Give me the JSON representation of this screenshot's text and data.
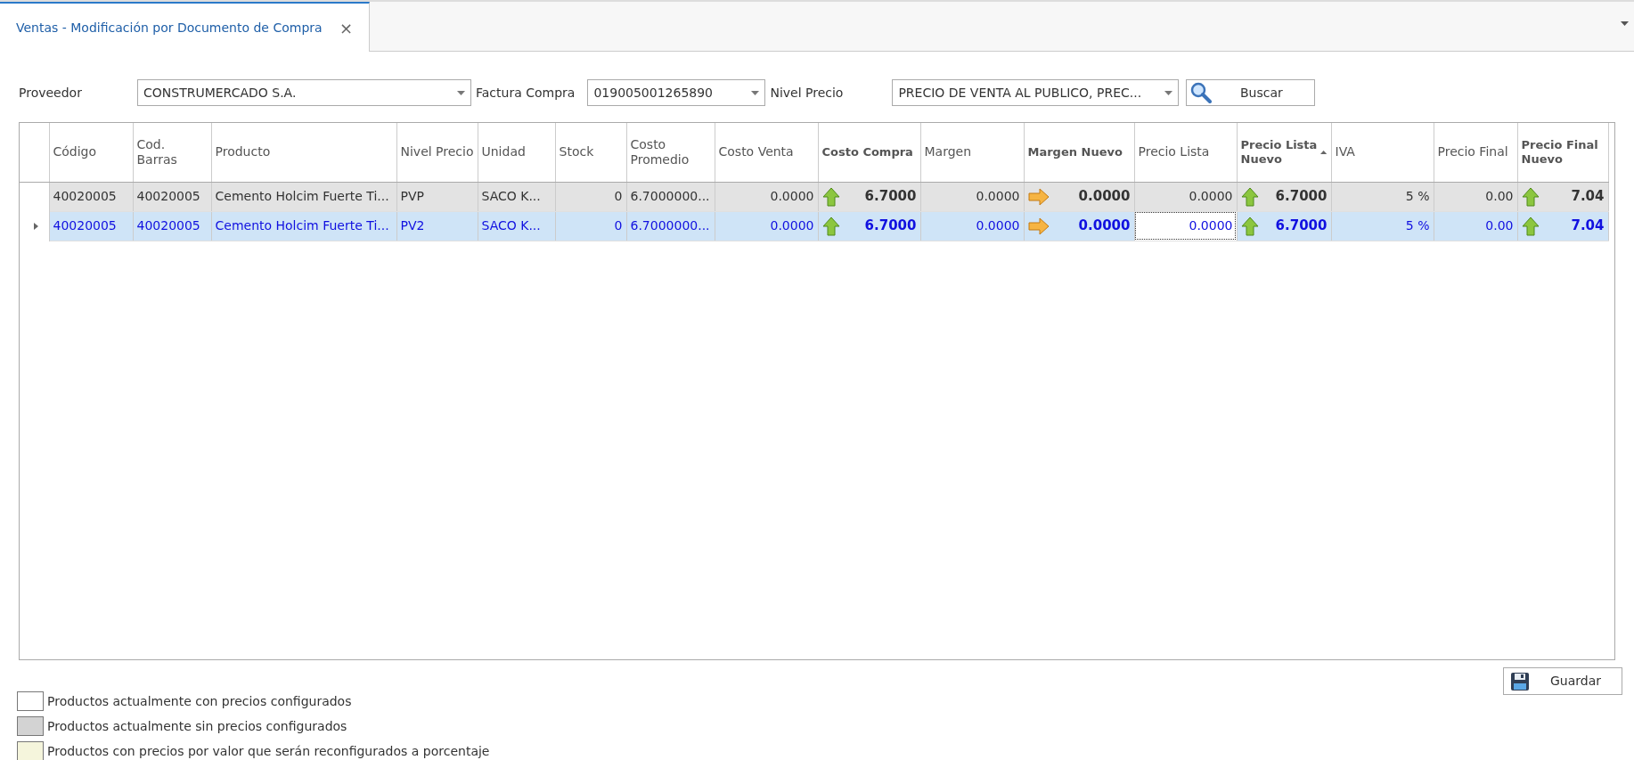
{
  "tab": {
    "title": "Ventas - Modificación por Documento de Compra",
    "close": "×",
    "selected": true
  },
  "filters": [
    {
      "label": "Proveedor",
      "value": "CONSTRUMERCADO S.A."
    },
    {
      "label": "Factura Compra",
      "value": "019005001265890"
    },
    {
      "label": "Nivel Precio",
      "value": "PRECIO DE VENTA AL PUBLICO, PREC..."
    }
  ],
  "search_button": "Buscar",
  "table": {
    "columns": [
      {
        "label": "Código",
        "bold": false,
        "kind": "text"
      },
      {
        "label": "Cod. Barras",
        "bold": false,
        "kind": "text"
      },
      {
        "label": "Producto",
        "bold": false,
        "kind": "text"
      },
      {
        "label": "Nivel Precio",
        "bold": false,
        "kind": "text"
      },
      {
        "label": "Unidad",
        "bold": false,
        "kind": "text"
      },
      {
        "label": "Stock",
        "bold": false,
        "kind": "number"
      },
      {
        "label": "Costo Promedio",
        "bold": false,
        "kind": "text"
      },
      {
        "label": "Costo Venta",
        "bold": false,
        "kind": "number"
      },
      {
        "label": "Costo Compra",
        "bold": true,
        "kind": "number"
      },
      {
        "label": "Margen",
        "bold": false,
        "kind": "number"
      },
      {
        "label": "Margen Nuevo",
        "bold": true,
        "kind": "number"
      },
      {
        "label": "Precio Lista",
        "bold": false,
        "kind": "number"
      },
      {
        "label": "Precio Lista Nuevo",
        "bold": true,
        "kind": "number",
        "sorted": true
      },
      {
        "label": "IVA",
        "bold": false,
        "kind": "number"
      },
      {
        "label": "Precio Final",
        "bold": false,
        "kind": "number"
      },
      {
        "label": "Precio Final Nuevo",
        "bold": true,
        "kind": "number"
      }
    ],
    "rows": [
      {
        "selected": false,
        "prices_configured": false,
        "cells": [
          {
            "text": "40020005"
          },
          {
            "text": "40020005"
          },
          {
            "text": "Cemento Holcim Fuerte Ti..."
          },
          {
            "text": "PVP"
          },
          {
            "text": "SACO K..."
          },
          {
            "text": "0"
          },
          {
            "text": "6.7000000..."
          },
          {
            "text": "0.0000"
          },
          {
            "text": "6.7000",
            "up_arrow": true
          },
          {
            "text": "0.0000"
          },
          {
            "text": "0.0000",
            "right_arrow": true
          },
          {
            "text": "0.0000"
          },
          {
            "text": "6.7000",
            "up_arrow": true
          },
          {
            "text": "5 %"
          },
          {
            "text": "0.00"
          },
          {
            "text": "7.04",
            "up_arrow": true
          }
        ]
      },
      {
        "selected": true,
        "cells": [
          {
            "text": "40020005"
          },
          {
            "text": "40020005"
          },
          {
            "text": "Cemento Holcim Fuerte Ti..."
          },
          {
            "text": "PV2"
          },
          {
            "text": "SACO K..."
          },
          {
            "text": "0"
          },
          {
            "text": "6.7000000..."
          },
          {
            "text": "0.0000"
          },
          {
            "text": "6.7000",
            "up_arrow": true
          },
          {
            "text": "0.0000"
          },
          {
            "text": "0.0000",
            "right_arrow": true
          },
          {
            "text": "0.0000",
            "focused": true
          },
          {
            "text": "6.7000",
            "up_arrow": true
          },
          {
            "text": "5 %"
          },
          {
            "text": "0.00"
          },
          {
            "text": "7.04",
            "up_arrow": true
          }
        ]
      }
    ]
  },
  "save_button": "Guardar",
  "legend": [
    {
      "label": "Productos actualmente con precios configurados",
      "color": "#ffffff"
    },
    {
      "label": "Productos actualmente sin precios configurados",
      "color": "#d3d3d3"
    },
    {
      "label": "Productos con precios por valor que serán reconfigurados a porcentaje",
      "color": "#f5f5dc"
    }
  ]
}
